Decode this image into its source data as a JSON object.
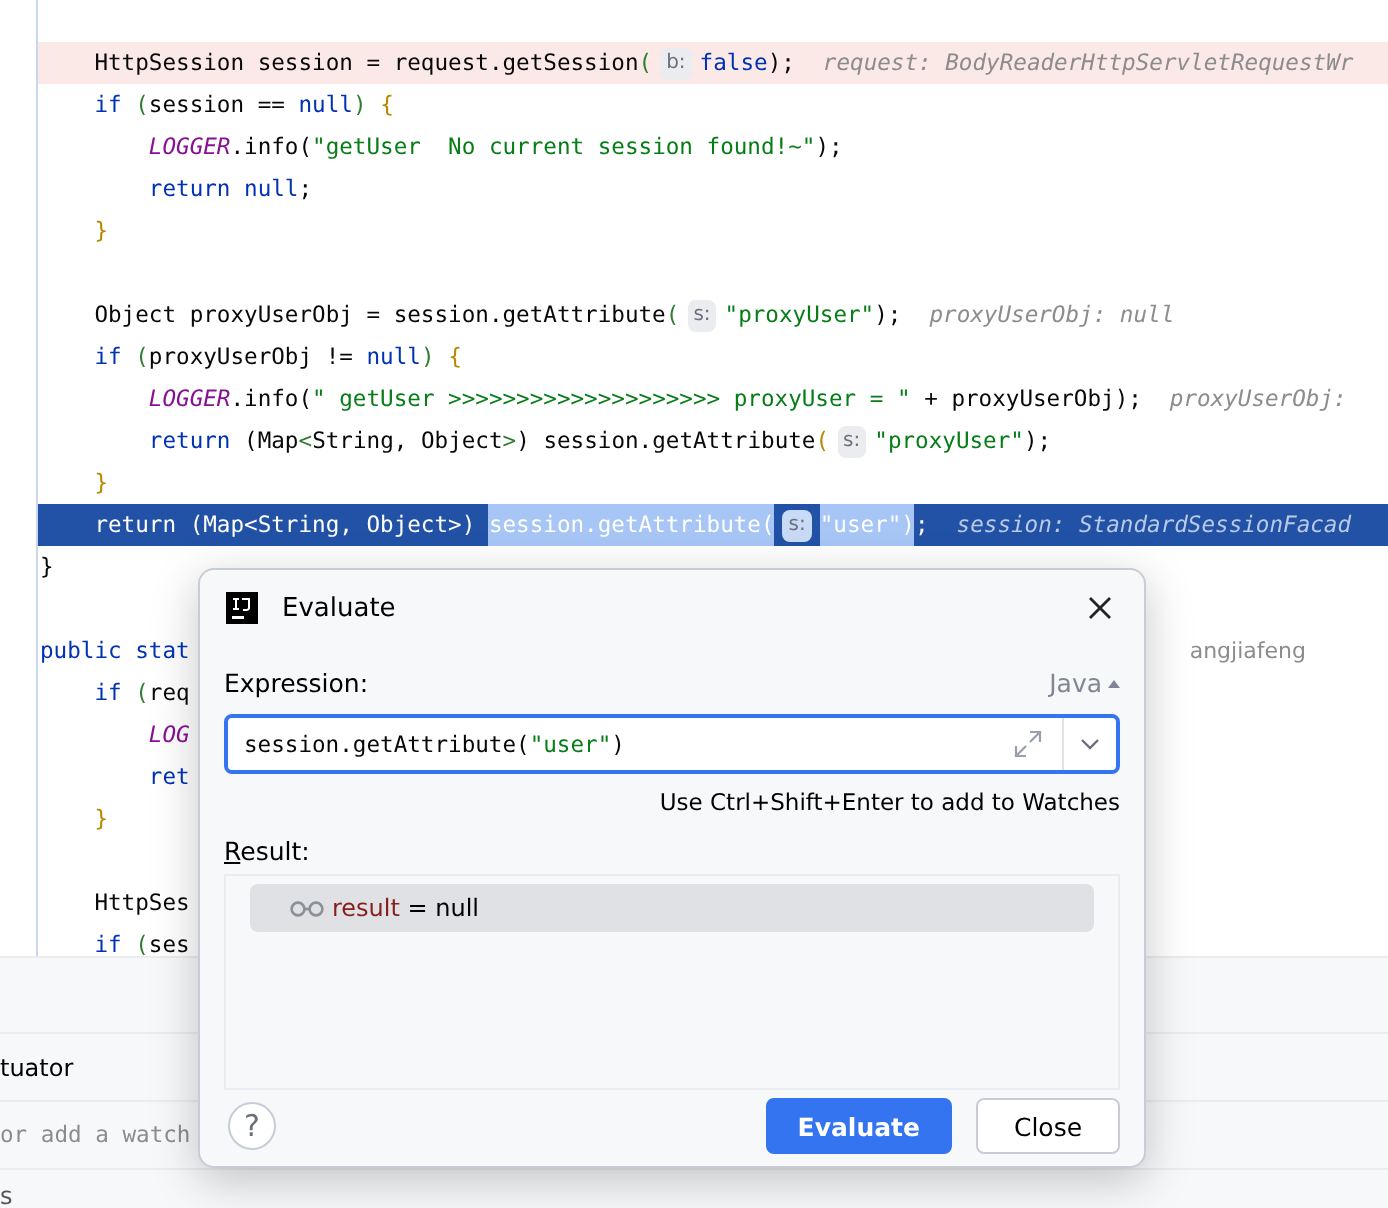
{
  "editor": {
    "lines": [
      {
        "kind": "execution",
        "parts": [
          {
            "kind": "code",
            "tokens": [
              {
                "kind": "plain",
                "text": "    HttpSession session = request.getSession"
              },
              {
                "kind": "bracket2",
                "text": "("
              }
            ]
          },
          {
            "kind": "param_hint",
            "text": "b:"
          },
          {
            "kind": "code",
            "tokens": [
              {
                "kind": "keyword",
                "text": "false"
              },
              {
                "kind": "plain",
                "text": ");"
              }
            ]
          },
          {
            "kind": "value_hint",
            "text": "request: BodyReaderHttpServletRequestWr"
          }
        ]
      },
      {
        "kind": "normal",
        "parts": [
          {
            "kind": "code",
            "tokens": [
              {
                "kind": "keyword",
                "text": "    if "
              },
              {
                "kind": "bracket2",
                "text": "("
              },
              {
                "kind": "plain",
                "text": "session == "
              },
              {
                "kind": "keyword",
                "text": "null"
              },
              {
                "kind": "bracket2",
                "text": ") "
              },
              {
                "kind": "bracket1",
                "text": "{"
              }
            ]
          }
        ]
      },
      {
        "kind": "normal",
        "parts": [
          {
            "kind": "code",
            "tokens": [
              {
                "kind": "field",
                "text": "        LOGGER"
              },
              {
                "kind": "plain",
                "text": ".info("
              },
              {
                "kind": "string",
                "text": "\"getUser  No current session found!~\""
              },
              {
                "kind": "plain",
                "text": ");"
              }
            ]
          }
        ]
      },
      {
        "kind": "normal",
        "parts": [
          {
            "kind": "code",
            "tokens": [
              {
                "kind": "keyword",
                "text": "        return null"
              },
              {
                "kind": "plain",
                "text": ";"
              }
            ]
          }
        ]
      },
      {
        "kind": "normal",
        "parts": [
          {
            "kind": "code",
            "tokens": [
              {
                "kind": "bracket1",
                "text": "    }"
              }
            ]
          }
        ]
      },
      {
        "kind": "normal"
      },
      {
        "kind": "normal",
        "parts": [
          {
            "kind": "code",
            "tokens": [
              {
                "kind": "plain",
                "text": "    Object proxyUserObj = session.getAttribute"
              },
              {
                "kind": "bracket2",
                "text": "("
              }
            ]
          },
          {
            "kind": "param_hint",
            "text": "s:"
          },
          {
            "kind": "code",
            "tokens": [
              {
                "kind": "string",
                "text": "\"proxyUser\""
              },
              {
                "kind": "plain",
                "text": ");"
              }
            ]
          },
          {
            "kind": "value_hint",
            "text": "proxyUserObj: null"
          }
        ]
      },
      {
        "kind": "normal",
        "parts": [
          {
            "kind": "code",
            "tokens": [
              {
                "kind": "keyword",
                "text": "    if "
              },
              {
                "kind": "bracket2",
                "text": "("
              },
              {
                "kind": "plain",
                "text": "proxyUserObj != "
              },
              {
                "kind": "keyword",
                "text": "null"
              },
              {
                "kind": "bracket2",
                "text": ") "
              },
              {
                "kind": "bracket1",
                "text": "{"
              }
            ]
          }
        ]
      },
      {
        "kind": "normal",
        "parts": [
          {
            "kind": "code",
            "tokens": [
              {
                "kind": "field",
                "text": "        LOGGER"
              },
              {
                "kind": "plain",
                "text": ".info("
              },
              {
                "kind": "string",
                "text": "\" getUser >>>>>>>>>>>>>>>>>>>> proxyUser = \""
              },
              {
                "kind": "plain",
                "text": " + proxyUserObj);"
              }
            ]
          },
          {
            "kind": "value_hint",
            "text": "proxyUserObj:"
          }
        ]
      },
      {
        "kind": "normal",
        "parts": [
          {
            "kind": "code",
            "tokens": [
              {
                "kind": "keyword",
                "text": "        return "
              },
              {
                "kind": "plain",
                "text": "(Map"
              },
              {
                "kind": "bracket2",
                "text": "<"
              },
              {
                "kind": "plain",
                "text": "String, Object"
              },
              {
                "kind": "bracket2",
                "text": ">"
              },
              {
                "kind": "plain",
                "text": ") session.getAttribute"
              },
              {
                "kind": "bracket1",
                "text": "("
              }
            ]
          },
          {
            "kind": "param_hint",
            "text": "s:"
          },
          {
            "kind": "code",
            "tokens": [
              {
                "kind": "string",
                "text": "\"proxyUser\""
              },
              {
                "kind": "plain",
                "text": ");"
              }
            ]
          }
        ]
      },
      {
        "kind": "normal",
        "parts": [
          {
            "kind": "code",
            "tokens": [
              {
                "kind": "bracket1",
                "text": "    }"
              }
            ]
          }
        ]
      },
      {
        "kind": "current",
        "parts": [
          {
            "kind": "code",
            "tokens": [
              {
                "kind": "plain",
                "text": "    return (Map<String, Object>) "
              }
            ]
          },
          {
            "kind": "selection",
            "tokens": [
              {
                "kind": "plain",
                "text": "session.getAttribute("
              }
            ]
          },
          {
            "kind": "param_hint",
            "text": "s:"
          },
          {
            "kind": "selection",
            "tokens": [
              {
                "kind": "plain",
                "text": "\"user\")"
              }
            ]
          },
          {
            "kind": "code",
            "tokens": [
              {
                "kind": "plain",
                "text": ";"
              }
            ]
          },
          {
            "kind": "value_hint",
            "text": "session: StandardSessionFacad"
          }
        ]
      },
      {
        "kind": "normal",
        "parts": [
          {
            "kind": "code",
            "tokens": [
              {
                "kind": "plain",
                "text": "}"
              }
            ]
          }
        ]
      },
      {
        "kind": "normal"
      },
      {
        "kind": "normal",
        "parts": [
          {
            "kind": "code",
            "tokens": [
              {
                "kind": "keyword",
                "text": "public stat"
              }
            ]
          },
          {
            "kind": "author_hint",
            "text": "angjiafeng"
          }
        ]
      },
      {
        "kind": "normal",
        "parts": [
          {
            "kind": "code",
            "tokens": [
              {
                "kind": "keyword",
                "text": "    if "
              },
              {
                "kind": "bracket2",
                "text": "("
              },
              {
                "kind": "plain",
                "text": "req"
              }
            ]
          }
        ]
      },
      {
        "kind": "normal",
        "parts": [
          {
            "kind": "code",
            "tokens": [
              {
                "kind": "field",
                "text": "        LOG"
              }
            ]
          }
        ]
      },
      {
        "kind": "normal",
        "parts": [
          {
            "kind": "code",
            "tokens": [
              {
                "kind": "keyword",
                "text": "        ret"
              }
            ]
          }
        ]
      },
      {
        "kind": "normal",
        "parts": [
          {
            "kind": "code",
            "tokens": [
              {
                "kind": "bracket1",
                "text": "    }"
              }
            ]
          }
        ]
      },
      {
        "kind": "normal"
      },
      {
        "kind": "normal",
        "parts": [
          {
            "kind": "code",
            "tokens": [
              {
                "kind": "plain",
                "text": "    HttpSes"
              }
            ]
          }
        ]
      },
      {
        "kind": "normal",
        "parts": [
          {
            "kind": "code",
            "tokens": [
              {
                "kind": "keyword",
                "text": "    if "
              },
              {
                "kind": "bracket2",
                "text": "("
              },
              {
                "kind": "plain",
                "text": "ses"
              }
            ]
          }
        ]
      }
    ]
  },
  "bottom_panel": {
    "title": "tuator",
    "watch_placeholder": "or add a watch",
    "row_3": "s"
  },
  "dialog": {
    "title": "Evaluate",
    "expression_label": "Expression:",
    "language": "Java",
    "expression": [
      {
        "kind": "plain",
        "text": "session.getAttribute("
      },
      {
        "kind": "string",
        "text": "\"user\""
      },
      {
        "kind": "plain",
        "text": ")"
      }
    ],
    "watch_hint": "Use Ctrl+Shift+Enter to add to Watches",
    "result_label": "Result:",
    "result": {
      "name": "result",
      "value": " = null",
      "selected": true
    },
    "help": "?",
    "buttons": [
      {
        "label": "Evaluate",
        "primary": true
      },
      {
        "label": "Close",
        "primary": false
      }
    ]
  }
}
